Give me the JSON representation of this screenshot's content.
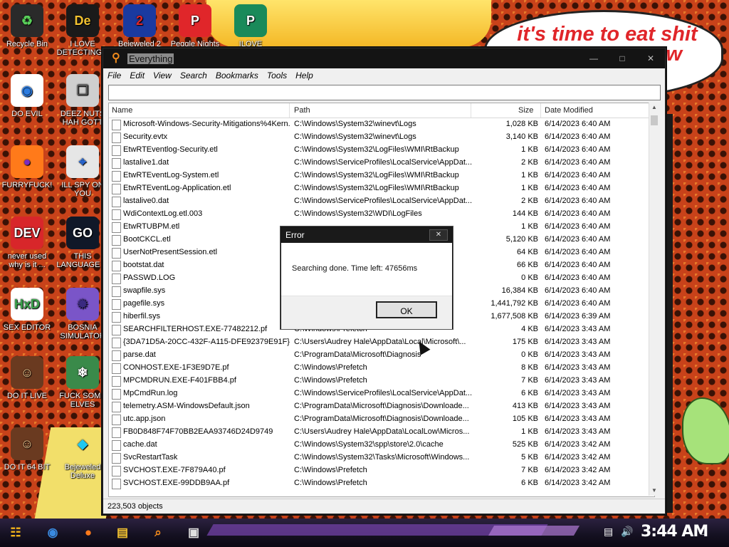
{
  "wallpaper": {
    "speech_lines": [
      "it's time to eat shit",
      "w"
    ]
  },
  "desktop_icons": [
    {
      "label": "Recycle Bin",
      "glyph": "♻",
      "bg": "#2a2a2a",
      "fg": "#5ad05a"
    },
    {
      "label": "I LOVE DETECTING...",
      "glyph": "De",
      "bg": "#1a1a1a",
      "fg": "#f2c230"
    },
    {
      "label": "DO EVIL",
      "glyph": "◉",
      "bg": "#ffffff",
      "fg": "#2c7ce0"
    },
    {
      "label": "DEEZ NUTS HAH GOTT",
      "glyph": "❐",
      "bg": "#cfcfcf",
      "fg": "#555555"
    },
    {
      "label": "FURRYFUCK!",
      "glyph": "●",
      "bg": "#ff7a1a",
      "fg": "#7a2cc0"
    },
    {
      "label": "ILL SPY ON YOU",
      "glyph": "⌖",
      "bg": "#e6e6e6",
      "fg": "#2a6ad8"
    },
    {
      "label": "never used why is it ...",
      "glyph": "DEV",
      "bg": "#d8262a",
      "fg": "#ffffff"
    },
    {
      "label": "THIS LANGUAGE ...",
      "glyph": "GO",
      "bg": "#101828",
      "fg": "#ffffff"
    },
    {
      "label": "SEX EDITOR",
      "glyph": "HxD",
      "bg": "#ffffff",
      "fg": "#3aa04a"
    },
    {
      "label": "BOSNIA SIMULATOR",
      "glyph": "✹",
      "bg": "#7a55c8",
      "fg": "#3a2a80"
    },
    {
      "label": "DO IT LIVE",
      "glyph": "☺",
      "bg": "#6a3a20",
      "fg": "#f0c890"
    },
    {
      "label": "FUCK SOME ELVES",
      "glyph": "❄",
      "bg": "#3a8a4a",
      "fg": "#ffffff"
    },
    {
      "label": "DO IT 64 BIT",
      "glyph": "☺",
      "bg": "#6a3a20",
      "fg": "#f0c890"
    },
    {
      "label": "Bejeweled Deluxe",
      "glyph": "◆",
      "bg": "transparent",
      "fg": "#1ec8f0"
    }
  ],
  "partial_icons": [
    {
      "label": "Bejeweled 2",
      "glyph": "2",
      "bg": "#1a3aa0",
      "fg": "#e0262a"
    },
    {
      "label": "Peggle Nights",
      "glyph": "P",
      "bg": "#e0262a",
      "fg": "#ffffff"
    },
    {
      "label": "ILOVE",
      "glyph": "P",
      "bg": "#1a8a5a",
      "fg": "#ffffff"
    }
  ],
  "window": {
    "title": "Everything",
    "menu": [
      "File",
      "Edit",
      "View",
      "Search",
      "Bookmarks",
      "Tools",
      "Help"
    ],
    "search_value": "",
    "columns": {
      "name": "Name",
      "path": "Path",
      "size": "Size",
      "date": "Date Modified"
    },
    "rows": [
      {
        "name": "Microsoft-Windows-Security-Mitigations%4Kern...",
        "path": "C:\\Windows\\System32\\winevt\\Logs",
        "size": "1,028 KB",
        "date": "6/14/2023 6:40 AM"
      },
      {
        "name": "Security.evtx",
        "path": "C:\\Windows\\System32\\winevt\\Logs",
        "size": "3,140 KB",
        "date": "6/14/2023 6:40 AM"
      },
      {
        "name": "EtwRTEventlog-Security.etl",
        "path": "C:\\Windows\\System32\\LogFiles\\WMI\\RtBackup",
        "size": "1 KB",
        "date": "6/14/2023 6:40 AM"
      },
      {
        "name": "lastalive1.dat",
        "path": "C:\\Windows\\ServiceProfiles\\LocalService\\AppDat...",
        "size": "2 KB",
        "date": "6/14/2023 6:40 AM"
      },
      {
        "name": "EtwRTEventLog-System.etl",
        "path": "C:\\Windows\\System32\\LogFiles\\WMI\\RtBackup",
        "size": "1 KB",
        "date": "6/14/2023 6:40 AM"
      },
      {
        "name": "EtwRTEventLog-Application.etl",
        "path": "C:\\Windows\\System32\\LogFiles\\WMI\\RtBackup",
        "size": "1 KB",
        "date": "6/14/2023 6:40 AM"
      },
      {
        "name": "lastalive0.dat",
        "path": "C:\\Windows\\ServiceProfiles\\LocalService\\AppDat...",
        "size": "2 KB",
        "date": "6/14/2023 6:40 AM"
      },
      {
        "name": "WdiContextLog.etl.003",
        "path": "C:\\Windows\\System32\\WDI\\LogFiles",
        "size": "144 KB",
        "date": "6/14/2023 6:40 AM"
      },
      {
        "name": "EtwRTUBPM.etl",
        "path": "",
        "size": "1 KB",
        "date": "6/14/2023 6:40 AM"
      },
      {
        "name": "BootCKCL.etl",
        "path": "",
        "size": "5,120 KB",
        "date": "6/14/2023 6:40 AM"
      },
      {
        "name": "UserNotPresentSession.etl",
        "path": "",
        "size": "64 KB",
        "date": "6/14/2023 6:40 AM"
      },
      {
        "name": "bootstat.dat",
        "path": "",
        "size": "66 KB",
        "date": "6/14/2023 6:40 AM"
      },
      {
        "name": "PASSWD.LOG",
        "path": "",
        "size": "0 KB",
        "date": "6/14/2023 6:40 AM"
      },
      {
        "name": "swapfile.sys",
        "path": "",
        "size": "16,384 KB",
        "date": "6/14/2023 6:40 AM"
      },
      {
        "name": "pagefile.sys",
        "path": "",
        "size": "1,441,792 KB",
        "date": "6/14/2023 6:40 AM"
      },
      {
        "name": "hiberfil.sys",
        "path": "",
        "size": "1,677,508 KB",
        "date": "6/14/2023 6:39 AM"
      },
      {
        "name": "SEARCHFILTERHOST.EXE-77482212.pf",
        "path": "C:\\Windows\\Prefetch",
        "size": "4 KB",
        "date": "6/14/2023 3:43 AM"
      },
      {
        "name": "{3DA71D5A-20CC-432F-A115-DFE92379E91F}...",
        "path": "C:\\Users\\Audrey Hale\\AppData\\Local\\Microsoft\\...",
        "size": "175 KB",
        "date": "6/14/2023 3:43 AM"
      },
      {
        "name": "parse.dat",
        "path": "C:\\ProgramData\\Microsoft\\Diagnosis",
        "size": "0 KB",
        "date": "6/14/2023 3:43 AM"
      },
      {
        "name": "CONHOST.EXE-1F3E9D7E.pf",
        "path": "C:\\Windows\\Prefetch",
        "size": "8 KB",
        "date": "6/14/2023 3:43 AM"
      },
      {
        "name": "MPCMDRUN.EXE-F401FBB4.pf",
        "path": "C:\\Windows\\Prefetch",
        "size": "7 KB",
        "date": "6/14/2023 3:43 AM"
      },
      {
        "name": "MpCmdRun.log",
        "path": "C:\\Windows\\ServiceProfiles\\LocalService\\AppDat...",
        "size": "6 KB",
        "date": "6/14/2023 3:43 AM"
      },
      {
        "name": "telemetry.ASM-WindowsDefault.json",
        "path": "C:\\ProgramData\\Microsoft\\Diagnosis\\Downloade...",
        "size": "413 KB",
        "date": "6/14/2023 3:43 AM"
      },
      {
        "name": "utc.app.json",
        "path": "C:\\ProgramData\\Microsoft\\Diagnosis\\Downloade...",
        "size": "105 KB",
        "date": "6/14/2023 3:43 AM"
      },
      {
        "name": "FB0D848F74F70BB2EAA93746D24D9749",
        "path": "C:\\Users\\Audrey Hale\\AppData\\LocalLow\\Micros...",
        "size": "1 KB",
        "date": "6/14/2023 3:43 AM"
      },
      {
        "name": "cache.dat",
        "path": "C:\\Windows\\System32\\spp\\store\\2.0\\cache",
        "size": "525 KB",
        "date": "6/14/2023 3:42 AM"
      },
      {
        "name": "SvcRestartTask",
        "path": "C:\\Windows\\System32\\Tasks\\Microsoft\\Windows...",
        "size": "5 KB",
        "date": "6/14/2023 3:42 AM"
      },
      {
        "name": "SVCHOST.EXE-7F879A40.pf",
        "path": "C:\\Windows\\Prefetch",
        "size": "7 KB",
        "date": "6/14/2023 3:42 AM"
      },
      {
        "name": "SVCHOST.EXE-99DDB9AA.pf",
        "path": "C:\\Windows\\Prefetch",
        "size": "6 KB",
        "date": "6/14/2023 3:42 AM"
      }
    ],
    "status": "223,503 objects"
  },
  "dialog": {
    "title": "Error",
    "close": "✕",
    "message": "Searching done. Time left: 47656ms",
    "ok_label": "OK"
  },
  "taskbar": {
    "items": [
      {
        "name": "start-button",
        "glyph": "☷",
        "color": "#f2b21a"
      },
      {
        "name": "chrome-taskbar-icon",
        "glyph": "◉",
        "color": "#3a8ae0"
      },
      {
        "name": "firefox-taskbar-icon",
        "glyph": "●",
        "color": "#ff7a1a"
      },
      {
        "name": "file-explorer-taskbar-icon",
        "glyph": "▤",
        "color": "#f2c230"
      },
      {
        "name": "everything-taskbar-icon",
        "glyph": "⌕",
        "color": "#f08a1c"
      },
      {
        "name": "media-taskbar-icon",
        "glyph": "▣",
        "color": "#e0e0e0"
      }
    ],
    "clock": "3:44 AM"
  }
}
